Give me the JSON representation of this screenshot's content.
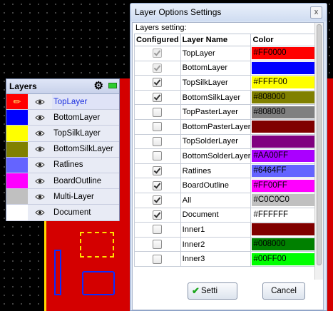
{
  "layers_panel": {
    "title": "Layers",
    "items": [
      {
        "name": "TopLayer",
        "color": "#FF0000",
        "selected": true,
        "icon": "pencil-icon"
      },
      {
        "name": "BottomLayer",
        "color": "#0000FF"
      },
      {
        "name": "TopSilkLayer",
        "color": "#FFFF00"
      },
      {
        "name": "BottomSilkLayer",
        "color": "#808000"
      },
      {
        "name": "Ratlines",
        "color": "#6464FF"
      },
      {
        "name": "BoardOutline",
        "color": "#FF00FF"
      },
      {
        "name": "Multi-Layer",
        "color": "#C0C0C0"
      },
      {
        "name": "Document",
        "color": "#FFFFFF"
      }
    ]
  },
  "dialog": {
    "title": "Layer Options Settings",
    "close_label": "x",
    "section_label": "Layers setting:",
    "columns": {
      "configured": "Configured",
      "name": "Layer Name",
      "color": "Color"
    },
    "rows": [
      {
        "configured": true,
        "disabled": true,
        "name": "TopLayer",
        "color": "#FF0000",
        "text_color": "#000000"
      },
      {
        "configured": true,
        "disabled": true,
        "name": "BottomLayer",
        "color": "#0000FF",
        "text_color": "#0000FF"
      },
      {
        "configured": true,
        "disabled": false,
        "name": "TopSilkLayer",
        "color": "#FFFF00",
        "text_color": "#000000"
      },
      {
        "configured": true,
        "disabled": false,
        "name": "BottomSilkLayer",
        "color": "#808000",
        "text_color": "#000000"
      },
      {
        "configured": false,
        "disabled": false,
        "name": "TopPasterLayer",
        "color": "#808080",
        "text_color": "#000000"
      },
      {
        "configured": false,
        "disabled": false,
        "name": "BottomPasterLayer",
        "color": "#800000",
        "text_color": "#800000"
      },
      {
        "configured": false,
        "disabled": false,
        "name": "TopSolderLayer",
        "color": "#800080",
        "text_color": "#800080"
      },
      {
        "configured": false,
        "disabled": false,
        "name": "BottomSolderLayer",
        "color": "#AA00FF",
        "text_color": "#000000"
      },
      {
        "configured": true,
        "disabled": false,
        "name": "Ratlines",
        "color": "#6464FF",
        "text_color": "#000000"
      },
      {
        "configured": true,
        "disabled": false,
        "name": "BoardOutline",
        "color": "#FF00FF",
        "text_color": "#000000"
      },
      {
        "configured": true,
        "disabled": false,
        "name": "All",
        "color": "#C0C0C0",
        "text_color": "#000000"
      },
      {
        "configured": true,
        "disabled": false,
        "name": "Document",
        "color": "#FFFFFF",
        "text_color": "#000000"
      },
      {
        "configured": false,
        "disabled": false,
        "name": "Inner1",
        "color": "#800000",
        "text_color": "#800000"
      },
      {
        "configured": false,
        "disabled": false,
        "name": "Inner2",
        "color": "#008000",
        "text_color": "#000000"
      },
      {
        "configured": false,
        "disabled": false,
        "name": "Inner3",
        "color": "#00FF00",
        "text_color": "#000000"
      }
    ],
    "buttons": {
      "settings": "Setti",
      "cancel": "Cancel"
    }
  }
}
